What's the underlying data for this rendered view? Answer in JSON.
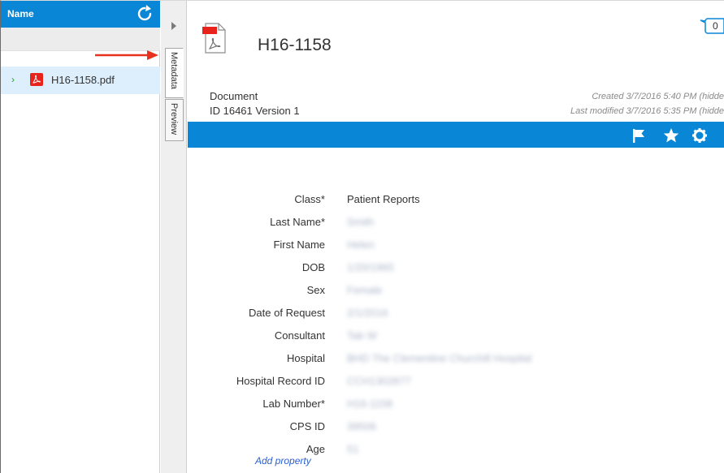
{
  "sidebar": {
    "header_title": "Name",
    "item_label": "H16-1158.pdf"
  },
  "tabs": {
    "metadata": "Metadata",
    "preview": "Preview"
  },
  "document": {
    "title": "H16-1158",
    "type": "Document",
    "id_version": "ID 16461  Version 1",
    "created": "Created 3/7/2016 5:40 PM (hidde",
    "modified": "Last modified 3/7/2016 5:35 PM (hidde",
    "comment_count": "0"
  },
  "properties": [
    {
      "label": "Class*",
      "value": "Patient Reports",
      "blurred": false
    },
    {
      "label": "Last Name*",
      "value": "Smith",
      "blurred": true
    },
    {
      "label": "First Name",
      "value": "Helen",
      "blurred": true
    },
    {
      "label": "DOB",
      "value": "1/20/1965",
      "blurred": true
    },
    {
      "label": "Sex",
      "value": "Female",
      "blurred": true
    },
    {
      "label": "Date of Request",
      "value": "2/1/2016",
      "blurred": true
    },
    {
      "label": "Consultant",
      "value": "Tab W",
      "blurred": true
    },
    {
      "label": "Hospital",
      "value": "BHD The Clementine Churchill Hospital",
      "blurred": true
    },
    {
      "label": "Hospital Record ID",
      "value": "CCH1302877",
      "blurred": true
    },
    {
      "label": "Lab Number*",
      "value": "H16-1158",
      "blurred": true
    },
    {
      "label": "CPS ID",
      "value": "39506",
      "blurred": true
    },
    {
      "label": "Age",
      "value": "51",
      "blurred": true
    }
  ],
  "add_property_label": "Add property",
  "icons": {
    "refresh": "refresh-icon",
    "collapse": "chevron-right-icon",
    "flag": "flag-icon",
    "star": "star-icon",
    "settings": "gear-icon",
    "comment": "comment-bubble-icon",
    "pdf": "pdf-icon"
  },
  "colors": {
    "accent": "#0a86d6",
    "selection": "#ddeefc",
    "pdf_red": "#e8231c",
    "link": "#2b5fd3"
  }
}
